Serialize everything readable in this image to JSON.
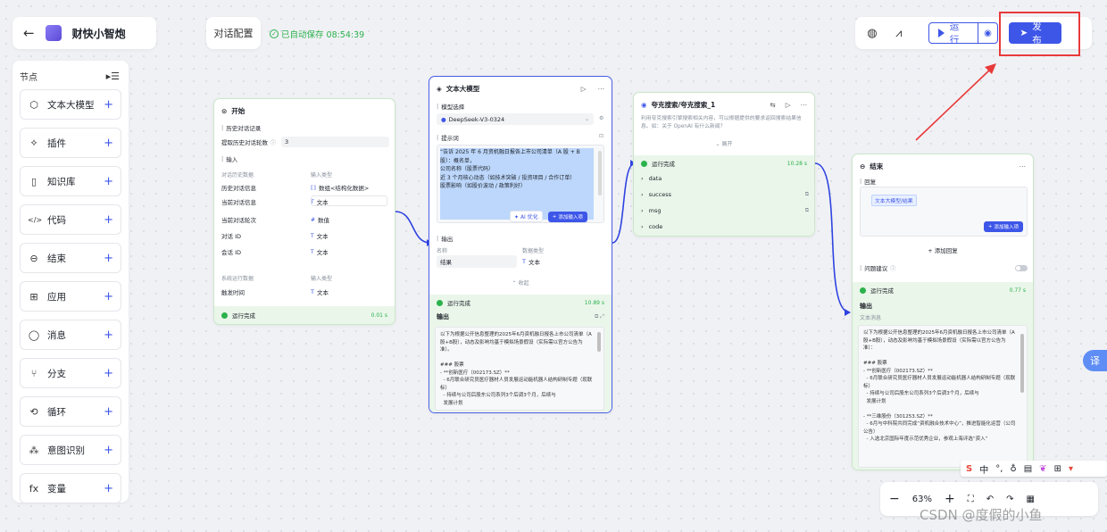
{
  "header": {
    "app_name": "财快小智炮",
    "config_tab": "对话配置",
    "autosave": "已自动保存 08:54:39",
    "run_label": "运行",
    "publish_label": "发布"
  },
  "sidebar": {
    "title": "节点",
    "items": [
      {
        "label": "文本大模型",
        "icon": "cube-icon"
      },
      {
        "label": "插件",
        "icon": "plugin-icon"
      },
      {
        "label": "知识库",
        "icon": "book-icon"
      },
      {
        "label": "代码",
        "icon": "code-icon"
      },
      {
        "label": "结束",
        "icon": "end-icon"
      },
      {
        "label": "应用",
        "icon": "apps-icon"
      },
      {
        "label": "消息",
        "icon": "message-icon"
      },
      {
        "label": "分支",
        "icon": "branch-icon"
      },
      {
        "label": "循环",
        "icon": "loop-icon"
      },
      {
        "label": "意图识别",
        "icon": "intent-icon"
      },
      {
        "label": "变量",
        "icon": "variable-icon"
      }
    ]
  },
  "start_node": {
    "title": "开始",
    "history_section": "历史对话记录",
    "history_count_label": "提取历史对话轮数",
    "history_count_value": "3",
    "input_section": "输入",
    "col_name": "对话历史数据",
    "col_type": "输入类型",
    "rows": [
      {
        "name": "历史对话信息",
        "type": "数组<结构化数据>"
      },
      {
        "name": "当前对话信息",
        "type": "文本"
      },
      {
        "name": "当前对话轮次",
        "type": "数值"
      },
      {
        "name": "对话 ID",
        "type": "文本"
      },
      {
        "name": "会话 ID",
        "type": "文本"
      }
    ],
    "col_name2": "系统运行数据",
    "col_type2": "输入类型",
    "rows2": [
      {
        "name": "触发时间",
        "type": "文本"
      }
    ],
    "status": "运行完成",
    "time": "0.01 s"
  },
  "llm_node": {
    "title": "文本大模型",
    "model_section": "模型选择",
    "model_value": "DeepSeek-V3-0324",
    "prompt_section": "提示词",
    "prompt_text": "“告诉 2025 年 6 月资机融日报各上市公司清单（A 股 + B 股）：概名单，\n公司名称（股票代码）\n近 3 个月核心动态（如技术突破 / 投资项目 / 合作订单）\n股票影响（如股价波动 / 政策利好）\n",
    "ai_optimize": "AI 优化",
    "add_input": "添加输入项",
    "output_section": "输出",
    "out_col_name": "名称",
    "out_col_type": "数据类型",
    "out_name": "结果",
    "out_type": "文本",
    "collapse": "收起",
    "status": "运行完成",
    "time": "10.89 s",
    "output_title": "输出",
    "output_text": "以下为根据公开信息整理的2025年6月资机融日报各上市公司清单（A股+B股），动态及影响均基于模拟场景假设（实际需以官方公告为准）。\n\n### 股票\n- **创新医疗（002173.SZ）**\n  - 6月联合研究员医疗器材人员发展运动能机器人结构研制专题（现联标）\n  - 持续与公司后股东公司系列3个后调3个月，后续与\n  发展计划"
  },
  "search_node": {
    "title": "夸克搜索/夸克搜索_1",
    "desc": "利用夸克搜索引擎搜索相关内容，可以根据提供的要求返回搜索结果信息。如：关于 OpenAI 有什么新闻？",
    "expand": "展开",
    "status": "运行完成",
    "time": "10.28 s",
    "outputs": [
      "data",
      "success",
      "msg",
      "code"
    ]
  },
  "end_node": {
    "title": "结束",
    "reply_section": "回复",
    "reply_tag": "文本大模型/结果",
    "add_input": "添加输入项",
    "add_reply": "添加回复",
    "suggest_label": "问题建议",
    "status": "运行完成",
    "time": "0.77 s",
    "output_title": "输出",
    "output_sub": "文本消息",
    "output_text": "以下为根据公开信息整理的2025年6月资机融日报各上市公司清单（A股+B股），动态及影响均基于模拟场景假设（实际需以官方公告为准）：\n\n### 股票\n- **创新医疗（002173.SZ）**\n  - 6月联合研究员医疗器材人员发展运动能机器人结构研制专题（现联标）\n  - 持续与公司后股东公司系列3个后调3个月，后续与\n  发展计划\n\n- **三维股份（301253.SZ）**\n  - 6月与中科院共同完成“资机融合技术中心”，推进智能化运营（公司公告）\n  - 入选北京国际年度示范优秀企业，参观上海评选“资入”"
  },
  "zoom": {
    "value": "63%"
  },
  "watermark": "CSDN @度假的小鱼"
}
